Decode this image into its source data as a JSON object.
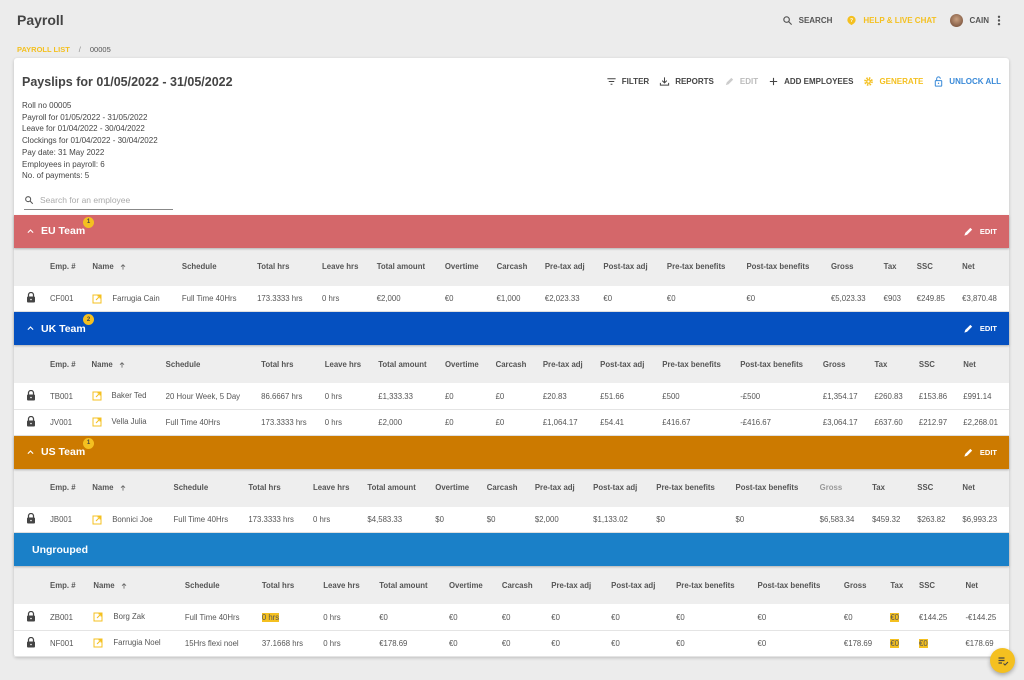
{
  "app": {
    "title": "Payroll"
  },
  "topbar": {
    "search": "SEARCH",
    "help": "HELP & LIVE CHAT",
    "user": "CAIN"
  },
  "breadcrumb": {
    "link": "PAYROLL LIST",
    "sep": "/",
    "current": "00005"
  },
  "card": {
    "title": "Payslips for 01/05/2022 - 31/05/2022",
    "actions": {
      "filter": "FILTER",
      "reports": "REPORTS",
      "edit": "EDIT",
      "add": "ADD EMPLOYEES",
      "generate": "GENERATE",
      "unlock": "UNLOCK ALL"
    },
    "info": [
      "Roll no 00005",
      "Payroll for 01/05/2022 - 31/05/2022",
      "Leave for 01/04/2022 - 30/04/2022",
      "Clockings for 01/04/2022 - 30/04/2022",
      "Pay date: 31 May 2022",
      "Employees in payroll: 6",
      "No. of payments: 5"
    ],
    "search_placeholder": "Search for an employee"
  },
  "columns": [
    "Emp. #",
    "Name",
    "Schedule",
    "Total hrs",
    "Leave hrs",
    "Total amount",
    "Overtime",
    "Carcash",
    "Pre-tax adj",
    "Post-tax adj",
    "Pre-tax benefits",
    "Post-tax benefits",
    "Gross",
    "Tax",
    "SSC",
    "Net"
  ],
  "groups": [
    {
      "name": "EU Team",
      "badge": "1",
      "color": "#d4676a",
      "edit": "EDIT",
      "rows": [
        {
          "cells": [
            "CF001",
            "Farrugia Cain",
            "Full Time 40Hrs",
            "173.3333 hrs",
            "0 hrs",
            "€2,000",
            "€0",
            "€1,000",
            "€2,023.33",
            "€0",
            "€0",
            "€0",
            "€5,023.33",
            "€903",
            "€249.85",
            "€3,870.48"
          ]
        }
      ]
    },
    {
      "name": "UK Team",
      "badge": "2",
      "color": "#0550c0",
      "edit": "EDIT",
      "rows": [
        {
          "cells": [
            "TB001",
            "Baker Ted",
            "20 Hour Week, 5 Day",
            "86.6667 hrs",
            "0 hrs",
            "£1,333.33",
            "£0",
            "£0",
            "£20.83",
            "£51.66",
            "£500",
            "-£500",
            "£1,354.17",
            "£260.83",
            "£153.86",
            "£991.14"
          ]
        },
        {
          "cells": [
            "JV001",
            "Vella Julia",
            "Full Time 40Hrs",
            "173.3333 hrs",
            "0 hrs",
            "£2,000",
            "£0",
            "£0",
            "£1,064.17",
            "£54.41",
            "£416.67",
            "-£416.67",
            "£3,064.17",
            "£637.60",
            "£212.97",
            "£2,268.01"
          ]
        }
      ]
    },
    {
      "name": "US Team",
      "badge": "1",
      "color": "#cc7a00",
      "edit": "EDIT",
      "gross_header_muted": true,
      "rows": [
        {
          "cells": [
            "JB001",
            "Bonnici Joe",
            "Full Time 40Hrs",
            "173.3333 hrs",
            "0 hrs",
            "$4,583.33",
            "$0",
            "$0",
            "$2,000",
            "$1,133.02",
            "$0",
            "$0",
            "$6,583.34",
            "$459.32",
            "$263.82",
            "$6,993.23"
          ]
        }
      ]
    },
    {
      "name": "Ungrouped",
      "badge": "",
      "color": "#1a80c8",
      "edit": "",
      "rows": [
        {
          "cells": [
            "ZB001",
            "Borg Zak",
            "Full Time 40Hrs",
            "0 hrs",
            "0 hrs",
            "€0",
            "€0",
            "€0",
            "€0",
            "€0",
            "€0",
            "€0",
            "€0",
            "€0",
            "€144.25",
            "-€144.25"
          ],
          "highlight": [
            3,
            13
          ]
        },
        {
          "cells": [
            "NF001",
            "Farrugia Noel",
            "15Hrs flexi noel",
            "37.1668 hrs",
            "0 hrs",
            "€178.69",
            "€0",
            "€0",
            "€0",
            "€0",
            "€0",
            "€0",
            "€178.69",
            "€0",
            "€0",
            "€178.69"
          ],
          "highlight": [
            13,
            14
          ]
        }
      ]
    }
  ],
  "colors": {
    "accent": "#f4c020",
    "link": "#3a8ad8"
  }
}
